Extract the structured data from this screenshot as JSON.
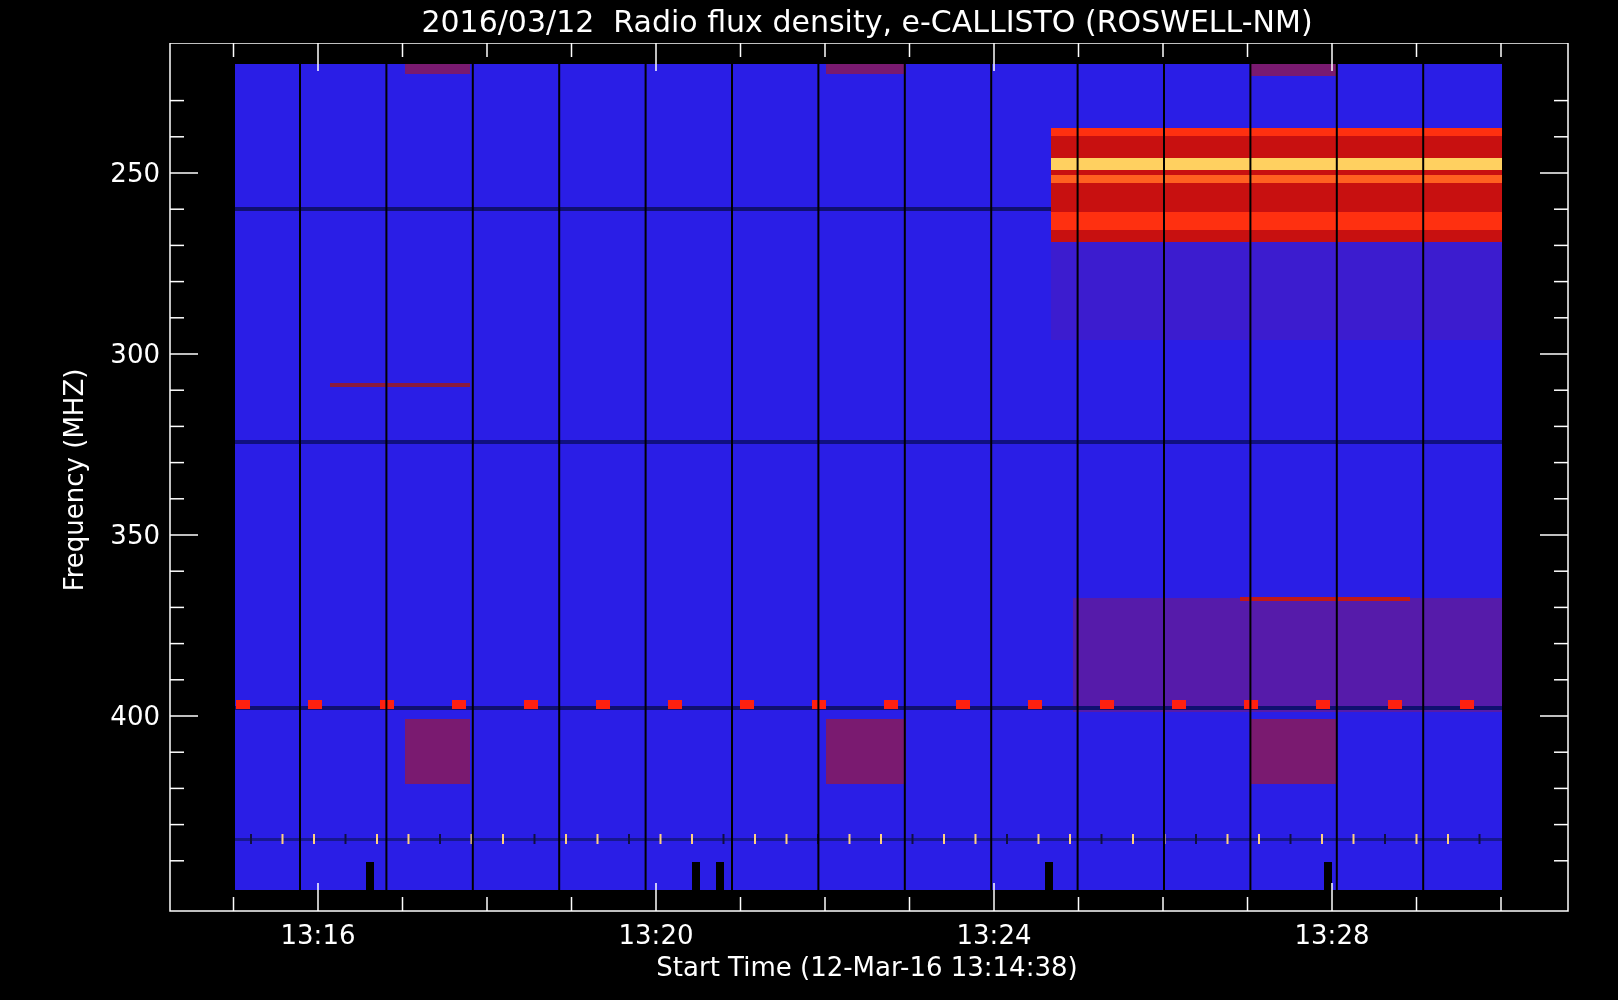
{
  "title": "2016/03/12  Radio flux density, e-CALLISTO (ROSWELL-NM)",
  "y_axis": {
    "label": "Frequency (MHZ)",
    "ticks": [
      "250",
      "300",
      "350",
      "400"
    ]
  },
  "x_axis": {
    "label": "Start Time (12-Mar-16 13:14:38)",
    "ticks": [
      "13:16",
      "13:20",
      "13:24",
      "13:28"
    ]
  }
}
